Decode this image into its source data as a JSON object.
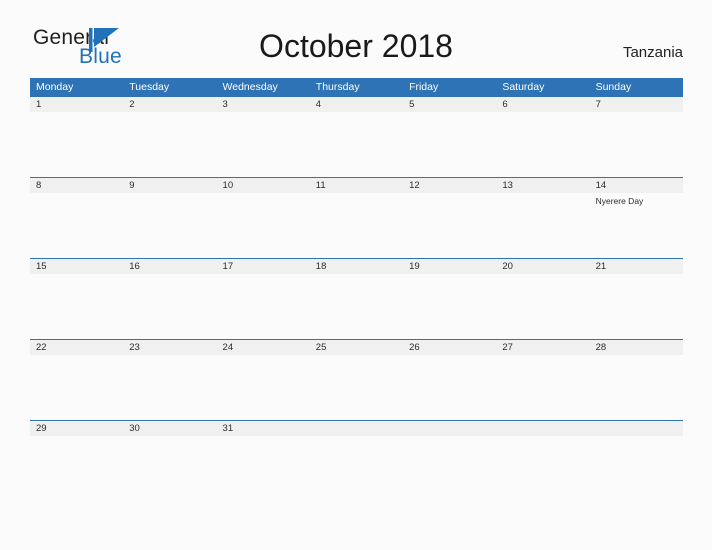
{
  "brand": {
    "name_top": "General",
    "name_bottom": "Blue",
    "mark_icon": "blue-flag-triangle-icon",
    "color_dark": "#231f20",
    "color_blue": "#2172b8"
  },
  "header": {
    "title": "October 2018",
    "country": "Tanzania"
  },
  "theme": {
    "header_blue": "#2e73b5",
    "date_stripe_gray": "#f0f0f0",
    "page_background": "#fbfbfb",
    "text_dark": "#2b2b2b"
  },
  "calendar": {
    "weekdays": [
      "Monday",
      "Tuesday",
      "Wednesday",
      "Thursday",
      "Friday",
      "Saturday",
      "Sunday"
    ],
    "weeks": [
      {
        "days": [
          {
            "date": "1",
            "event": ""
          },
          {
            "date": "2",
            "event": ""
          },
          {
            "date": "3",
            "event": ""
          },
          {
            "date": "4",
            "event": ""
          },
          {
            "date": "5",
            "event": ""
          },
          {
            "date": "6",
            "event": ""
          },
          {
            "date": "7",
            "event": ""
          }
        ]
      },
      {
        "days": [
          {
            "date": "8",
            "event": ""
          },
          {
            "date": "9",
            "event": ""
          },
          {
            "date": "10",
            "event": ""
          },
          {
            "date": "11",
            "event": ""
          },
          {
            "date": "12",
            "event": ""
          },
          {
            "date": "13",
            "event": ""
          },
          {
            "date": "14",
            "event": "Nyerere Day"
          }
        ]
      },
      {
        "days": [
          {
            "date": "15",
            "event": ""
          },
          {
            "date": "16",
            "event": ""
          },
          {
            "date": "17",
            "event": ""
          },
          {
            "date": "18",
            "event": ""
          },
          {
            "date": "19",
            "event": ""
          },
          {
            "date": "20",
            "event": ""
          },
          {
            "date": "21",
            "event": ""
          }
        ]
      },
      {
        "days": [
          {
            "date": "22",
            "event": ""
          },
          {
            "date": "23",
            "event": ""
          },
          {
            "date": "24",
            "event": ""
          },
          {
            "date": "25",
            "event": ""
          },
          {
            "date": "26",
            "event": ""
          },
          {
            "date": "27",
            "event": ""
          },
          {
            "date": "28",
            "event": ""
          }
        ]
      },
      {
        "days": [
          {
            "date": "29",
            "event": ""
          },
          {
            "date": "30",
            "event": ""
          },
          {
            "date": "31",
            "event": ""
          },
          {
            "date": "",
            "event": ""
          },
          {
            "date": "",
            "event": ""
          },
          {
            "date": "",
            "event": ""
          },
          {
            "date": "",
            "event": ""
          }
        ]
      }
    ]
  }
}
